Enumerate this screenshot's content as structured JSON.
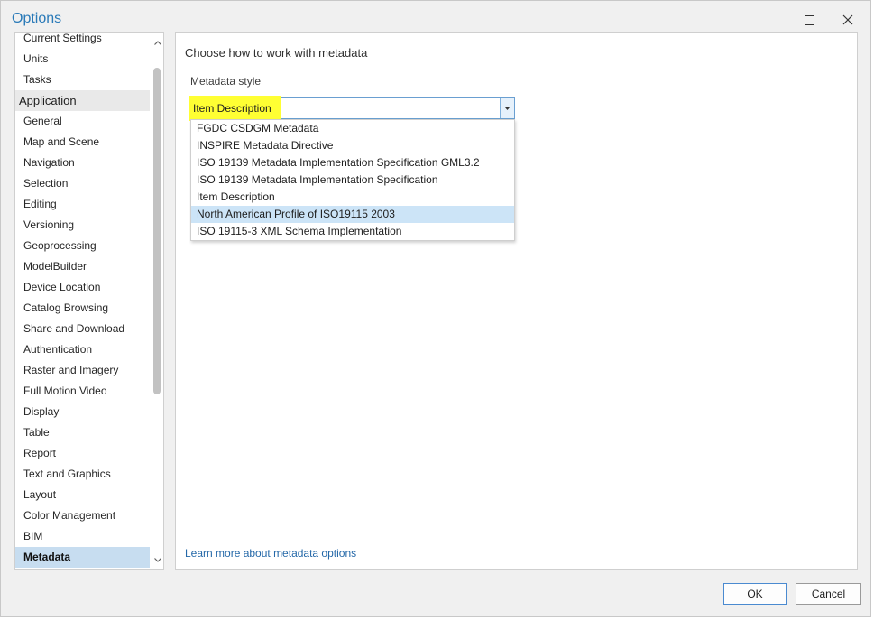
{
  "window": {
    "title": "Options"
  },
  "nav": {
    "items_before": [
      "Current Settings",
      "Units",
      "Tasks"
    ],
    "header": "Application",
    "items": [
      "General",
      "Map and Scene",
      "Navigation",
      "Selection",
      "Editing",
      "Versioning",
      "Geoprocessing",
      "ModelBuilder",
      "Device Location",
      "Catalog Browsing",
      "Share and Download",
      "Authentication",
      "Raster and Imagery",
      "Full Motion Video",
      "Display",
      "Table",
      "Report",
      "Text and Graphics",
      "Layout",
      "Color Management",
      "BIM",
      "Metadata"
    ],
    "selected": "Metadata"
  },
  "content": {
    "heading": "Choose how to work with metadata",
    "field_label": "Metadata style",
    "combo_value": "Item Description",
    "options": [
      "FGDC CSDGM Metadata",
      "INSPIRE Metadata Directive",
      "ISO 19139 Metadata Implementation Specification GML3.2",
      "ISO 19139 Metadata Implementation Specification",
      "Item Description",
      "North American Profile of ISO19115 2003",
      "ISO 19115-3 XML Schema Implementation"
    ],
    "highlighted_option": "North American Profile of ISO19115 2003",
    "learn_link": "Learn more about metadata options"
  },
  "buttons": {
    "ok": "OK",
    "cancel": "Cancel"
  },
  "colors": {
    "title": "#2a7ab8",
    "link": "#2468a8",
    "highlight_marker": "#ffff33",
    "selected_nav": "#c7ddf0",
    "hover_option": "#cce4f7"
  },
  "icons": {
    "maximize": "maximize-icon",
    "close": "close-icon",
    "dropdown": "chevron-down-icon",
    "scroll_up": "chevron-up-icon",
    "scroll_down": "chevron-down-icon"
  }
}
